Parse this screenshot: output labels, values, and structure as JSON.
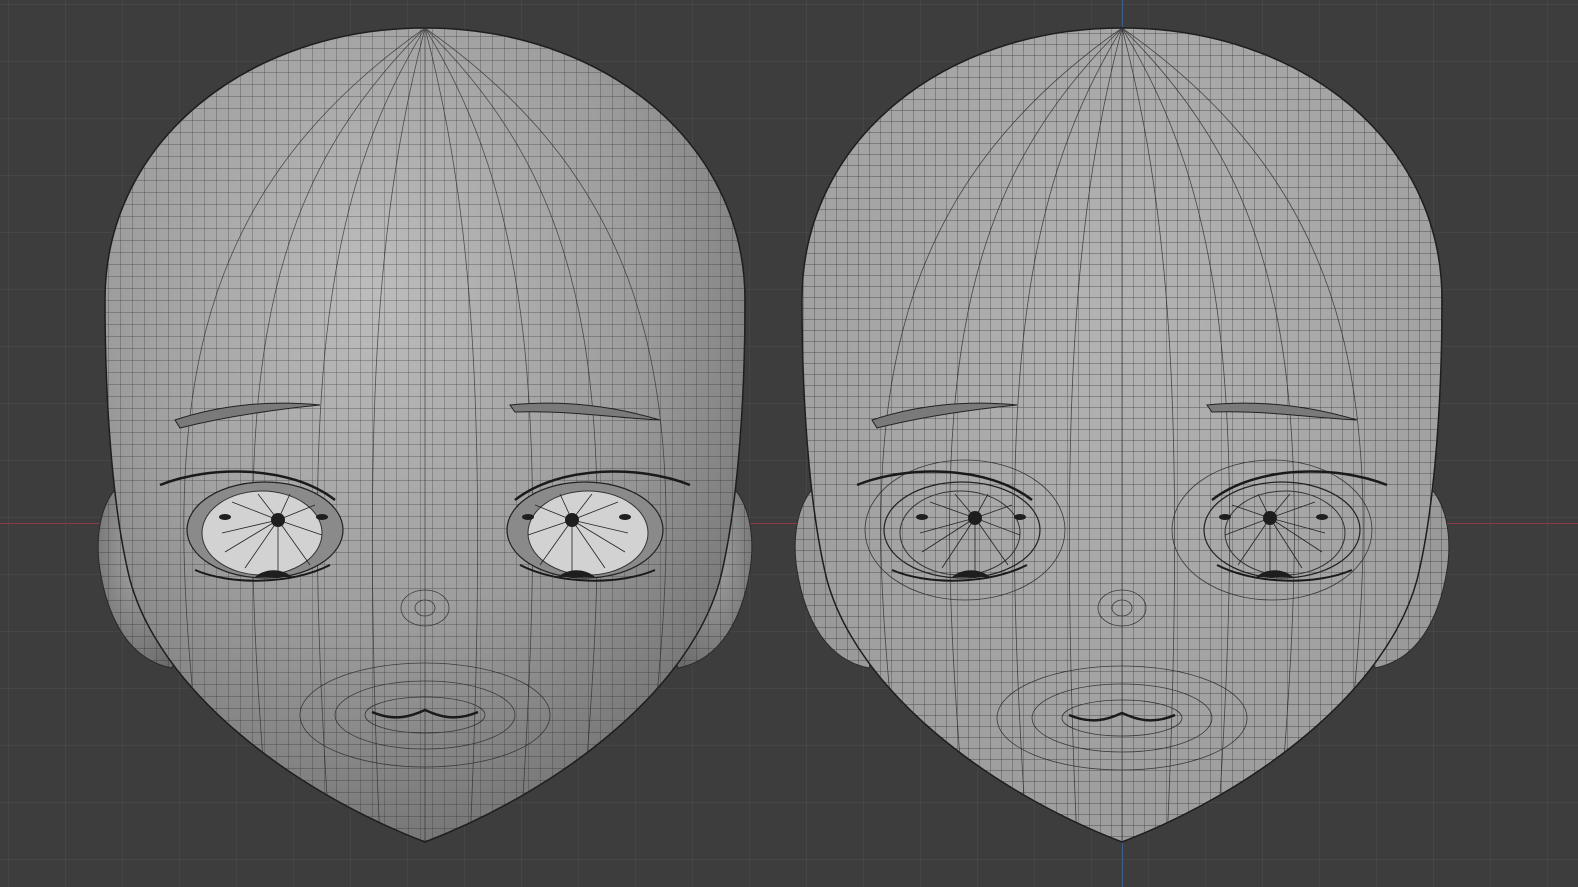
{
  "viewport": {
    "background_color": "#3d3d3d",
    "grid_color": "#474747",
    "x_axis_color": "#8e3a44",
    "y_axis_color": "#3f5f8e"
  },
  "objects": [
    {
      "name": "head-mesh-shaded",
      "shading": "smooth",
      "base_color": "#9a9a9a"
    },
    {
      "name": "head-mesh-wireframe",
      "shading": "flat",
      "base_color": "#a8a8a8"
    }
  ],
  "wire_color": "#262626"
}
